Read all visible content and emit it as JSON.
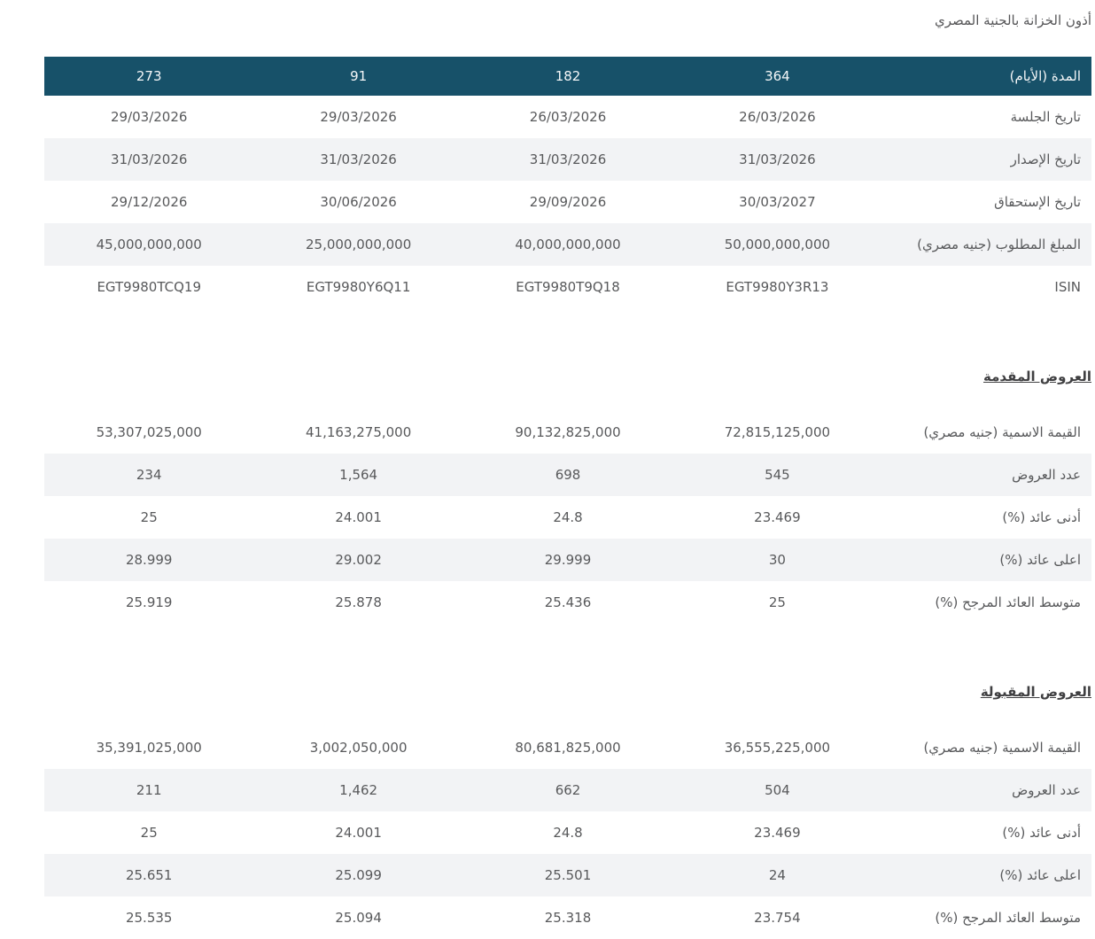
{
  "page": {
    "title": "أذون الخزانة بالجنية المصري"
  },
  "colors": {
    "header_bg": "#175169",
    "row_alt_bg": "#f2f3f5",
    "body_text": "#58595b"
  },
  "main_table": {
    "header": {
      "label": "المدة (الأيام)",
      "columns": [
        "364",
        "182",
        "91",
        "273"
      ]
    },
    "rows": [
      {
        "label": "تاريخ الجلسة",
        "values": [
          "26/03/2026",
          "26/03/2026",
          "29/03/2026",
          "29/03/2026"
        ]
      },
      {
        "label": "تاريخ الإصدار",
        "values": [
          "31/03/2026",
          "31/03/2026",
          "31/03/2026",
          "31/03/2026"
        ]
      },
      {
        "label": "تاريخ الإستحقاق",
        "values": [
          "30/03/2027",
          "29/09/2026",
          "30/06/2026",
          "29/12/2026"
        ]
      },
      {
        "label": "المبلغ المطلوب (جنيه مصري)",
        "values": [
          "50,000,000,000",
          "40,000,000,000",
          "25,000,000,000",
          "45,000,000,000"
        ]
      },
      {
        "label": "ISIN",
        "values": [
          "EGT9980Y3R13",
          "EGT9980T9Q18",
          "EGT9980Y6Q11",
          "EGT9980TCQ19"
        ]
      }
    ]
  },
  "sections": [
    {
      "title": "العروض المقدمة",
      "rows": [
        {
          "label": "القيمة الاسمية (جنيه مصري)",
          "values": [
            "72,815,125,000",
            "90,132,825,000",
            "41,163,275,000",
            "53,307,025,000"
          ]
        },
        {
          "label": "عدد العروض",
          "values": [
            "545",
            "698",
            "1,564",
            "234"
          ]
        },
        {
          "label": "أدنى عائد (%)",
          "values": [
            "23.469",
            "24.8",
            "24.001",
            "25"
          ]
        },
        {
          "label": "اعلى عائد (%)",
          "values": [
            "30",
            "29.999",
            "29.002",
            "28.999"
          ]
        },
        {
          "label": "متوسط العائد المرجح (%)",
          "values": [
            "25",
            "25.436",
            "25.878",
            "25.919"
          ]
        }
      ]
    },
    {
      "title": "العروض المقبولة",
      "rows": [
        {
          "label": "القيمة الاسمية (جنيه مصري)",
          "values": [
            "36,555,225,000",
            "80,681,825,000",
            "3,002,050,000",
            "35,391,025,000"
          ]
        },
        {
          "label": "عدد العروض",
          "values": [
            "504",
            "662",
            "1,462",
            "211"
          ]
        },
        {
          "label": "أدنى عائد (%)",
          "values": [
            "23.469",
            "24.8",
            "24.001",
            "25"
          ]
        },
        {
          "label": "اعلى عائد (%)",
          "values": [
            "24",
            "25.501",
            "25.099",
            "25.651"
          ]
        },
        {
          "label": "متوسط العائد المرجح (%)",
          "values": [
            "23.754",
            "25.318",
            "25.094",
            "25.535"
          ]
        }
      ]
    }
  ]
}
